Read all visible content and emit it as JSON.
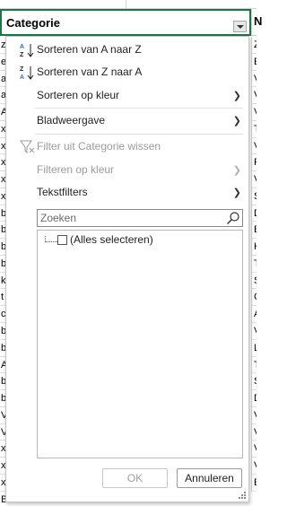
{
  "sheet": {
    "column_a_header": "Categorie",
    "column_b_header": "N",
    "left_cells": [
      "z",
      "e",
      "a",
      "a",
      "A",
      "x",
      "x",
      "x",
      "x",
      "x",
      "b",
      "b",
      "b",
      "b",
      "k",
      "t",
      "c",
      "b",
      "b",
      "A",
      "b",
      "b",
      "V",
      "V",
      "x",
      "x",
      "x",
      "B"
    ],
    "right_cells": [
      "Z",
      "E",
      "V",
      "V",
      "V",
      "T",
      "V",
      "F",
      "V",
      "S",
      "D",
      "E",
      "K",
      "T",
      "S",
      "C",
      "A",
      "V",
      "L",
      "T",
      "S",
      "D",
      "V",
      "V",
      "V",
      "V",
      "E"
    ]
  },
  "menu": {
    "sort_az": "Sorteren van A naar Z",
    "sort_za": "Sorteren van Z naar A",
    "sort_color": "Sorteren op kleur",
    "sheet_view": "Bladweergave",
    "clear_filter": "Filter uit Categorie wissen",
    "filter_color": "Filteren op kleur",
    "text_filters": "Tekstfilters"
  },
  "search": {
    "placeholder": "Zoeken"
  },
  "list": {
    "select_all": "(Alles selecteren)"
  },
  "buttons": {
    "ok": "OK",
    "cancel": "Annuleren"
  },
  "colors": {
    "accent_green": "#217346",
    "sort_blue": "#2b78c5"
  }
}
